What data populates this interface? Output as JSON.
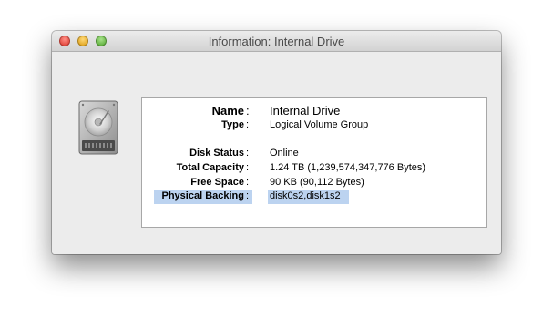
{
  "window": {
    "title": "Information: Internal Drive"
  },
  "icons": {
    "drive": "hard-drive-icon",
    "close": "close-icon",
    "minimize": "minimize-icon",
    "zoom": "zoom-icon"
  },
  "info": {
    "name": {
      "label": "Name",
      "value": "Internal Drive"
    },
    "type": {
      "label": "Type",
      "value": "Logical Volume Group"
    },
    "disk_status": {
      "label": "Disk Status",
      "value": "Online"
    },
    "total_capacity": {
      "label": "Total Capacity",
      "value": "1.24 TB (1,239,574,347,776 Bytes)"
    },
    "free_space": {
      "label": "Free Space",
      "value": "90 KB (90,112 Bytes)"
    },
    "physical_backing": {
      "label": "Physical Backing",
      "value": "disk0s2,disk1s2"
    },
    "separator": ":"
  },
  "colors": {
    "selection": "#bcd3f0",
    "window_bg": "#ececec"
  }
}
